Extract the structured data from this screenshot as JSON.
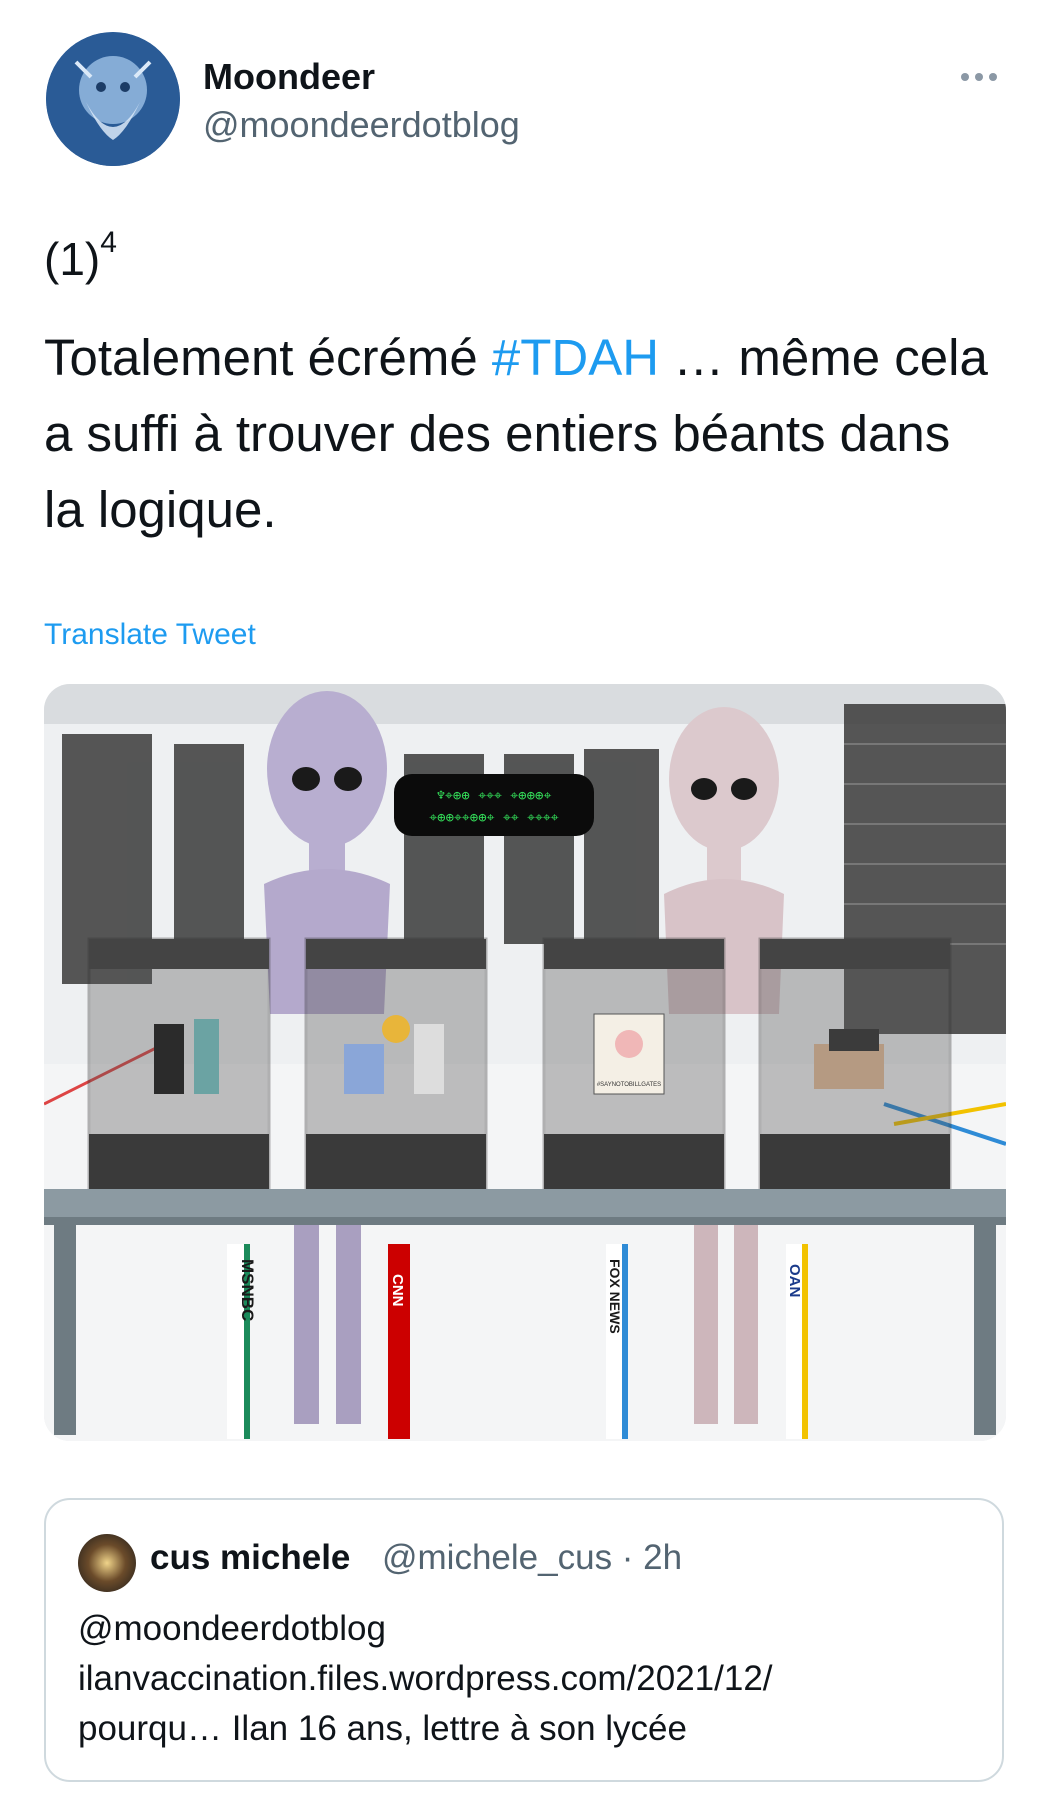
{
  "author": {
    "display_name": "Moondeer",
    "handle": "@moondeerdotblog"
  },
  "tweet": {
    "counter_base": "(1)",
    "counter_exp": "4",
    "text_before": "Totalement écrémé ",
    "hashtag": "#TDAH",
    "text_after": " … même cela a suffi à trouver des entiers béants dans la logique.",
    "translate_label": "Translate Tweet"
  },
  "media": {
    "speech_line1": "♆⌖⊕⊕ ⌖⌖⌖ ⌖⊕⊕⊕⌖",
    "speech_line2": "⌖⊕⊕⌖⌖⊕⊕⌖ ⌖⌖ ⌖⌖⌖⌖",
    "network_labels": [
      "MSNBC",
      "CNN",
      "FOX NEWS",
      "OAN"
    ],
    "sign_text": "#SAYNOTOBILLGATES",
    "colors": {
      "msnbc": "#1b8a5a",
      "cnn": "#cc0000",
      "fox": "#2e8bd6",
      "oan": "#f2c200"
    }
  },
  "quote": {
    "name": "cus michele",
    "handle_time": "@michele_cus · 2h",
    "line1": "@moondeerdotblog",
    "line2": "ilanvaccination.files.wordpress.com/2021/12/",
    "line3": "pourqu… Ilan 16 ans, lettre à son lycée"
  }
}
